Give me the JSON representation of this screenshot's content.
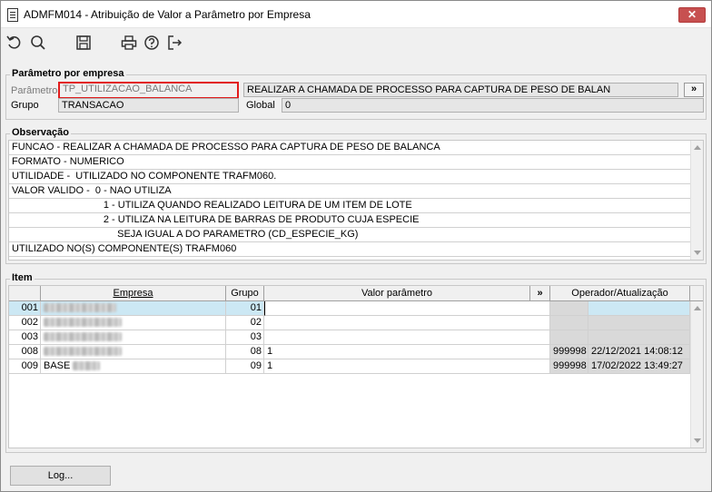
{
  "window": {
    "title": "ADMFM014 - Atribuição de Valor a Parâmetro por Empresa",
    "close_label": "✕"
  },
  "toolbar": {
    "buttons": [
      {
        "icon": "undo-icon"
      },
      {
        "icon": "search-icon"
      },
      {
        "icon": "save-icon"
      },
      {
        "icon": "print-icon"
      },
      {
        "icon": "help-icon"
      },
      {
        "icon": "exit-icon"
      }
    ]
  },
  "parametro": {
    "group_label": "Parâmetro por empresa",
    "parametro_label": "Parâmetro",
    "parametro_value": "TP_UTILIZACAO_BALANCA",
    "descricao": "REALIZAR A CHAMADA DE PROCESSO PARA CAPTURA DE PESO DE BALAN",
    "more_button": "»",
    "grupo_label": "Grupo",
    "grupo_value": "TRANSACAO",
    "global_label": "Global",
    "global_value": "0"
  },
  "observacao": {
    "group_label": "Observação",
    "lines": [
      "FUNCAO - REALIZAR A CHAMADA DE PROCESSO PARA CAPTURA DE PESO DE BALANCA",
      "FORMATO - NUMERICO",
      "UTILIDADE -  UTILIZADO NO COMPONENTE TRAFM060.",
      "VALOR VALIDO -  0 - NAO UTILIZA",
      "                                 1 - UTILIZA QUANDO REALIZADO LEITURA DE UM ITEM DE LOTE",
      "                                 2 - UTILIZA NA LEITURA DE BARRAS DE PRODUTO CUJA ESPECIE",
      "                                      SEJA IGUAL A DO PARAMETRO (CD_ESPECIE_KG)",
      "UTILIZADO NO(S) COMPONENTE(S) TRAFM060"
    ]
  },
  "item": {
    "group_label": "Item",
    "columns": {
      "empresa": "Empresa",
      "grupo": "Grupo",
      "valor": "Valor parâmetro",
      "more": "»",
      "operador": "Operador/Atualização"
    },
    "rows": [
      {
        "codigo": "001",
        "empresa": "",
        "grupo": "01",
        "valor": "",
        "operador": "",
        "atualizacao": ""
      },
      {
        "codigo": "002",
        "empresa": "",
        "grupo": "02",
        "valor": "",
        "operador": "",
        "atualizacao": ""
      },
      {
        "codigo": "003",
        "empresa": "",
        "grupo": "03",
        "valor": "",
        "operador": "",
        "atualizacao": ""
      },
      {
        "codigo": "008",
        "empresa": "",
        "grupo": "08",
        "valor": "1",
        "operador": "999998",
        "atualizacao": "22/12/2021 14:08:12"
      },
      {
        "codigo": "009",
        "empresa": "BASE",
        "grupo": "09",
        "valor": "1",
        "operador": "999998",
        "atualizacao": "17/02/2022 13:49:27"
      }
    ]
  },
  "footer": {
    "log_button": "Log..."
  }
}
